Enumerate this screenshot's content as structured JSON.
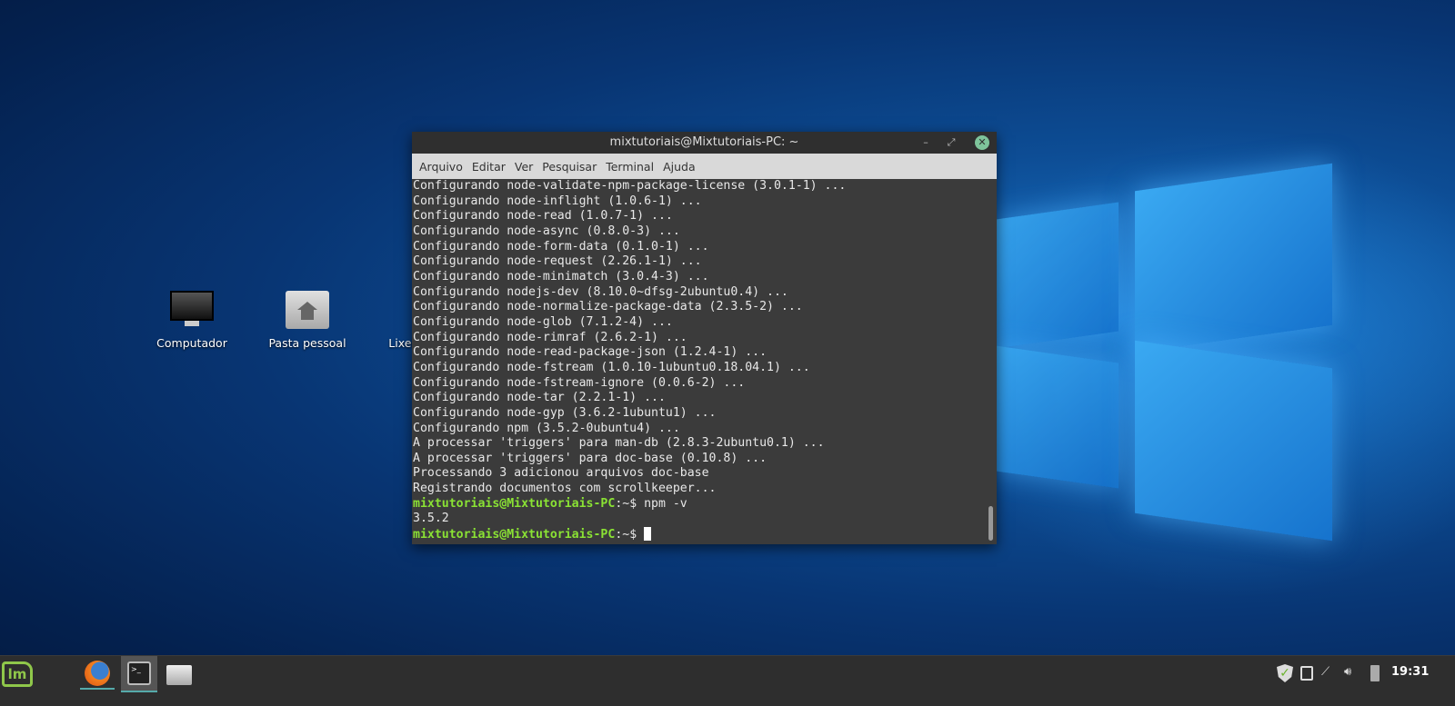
{
  "desktop": {
    "icons": [
      {
        "label": "Computador"
      },
      {
        "label": "Pasta pessoal"
      },
      {
        "label": "Lixeira"
      }
    ]
  },
  "terminal": {
    "title": "mixtutoriais@Mixtutoriais-PC: ~",
    "menu": [
      "Arquivo",
      "Editar",
      "Ver",
      "Pesquisar",
      "Terminal",
      "Ajuda"
    ],
    "lines": [
      "Configurando node-validate-npm-package-license (3.0.1-1) ...",
      "Configurando node-inflight (1.0.6-1) ...",
      "Configurando node-read (1.0.7-1) ...",
      "Configurando node-async (0.8.0-3) ...",
      "Configurando node-form-data (0.1.0-1) ...",
      "Configurando node-request (2.26.1-1) ...",
      "Configurando node-minimatch (3.0.4-3) ...",
      "Configurando nodejs-dev (8.10.0~dfsg-2ubuntu0.4) ...",
      "Configurando node-normalize-package-data (2.3.5-2) ...",
      "Configurando node-glob (7.1.2-4) ...",
      "Configurando node-rimraf (2.6.2-1) ...",
      "Configurando node-read-package-json (1.2.4-1) ...",
      "Configurando node-fstream (1.0.10-1ubuntu0.18.04.1) ...",
      "Configurando node-fstream-ignore (0.0.6-2) ...",
      "Configurando node-tar (2.2.1-1) ...",
      "Configurando node-gyp (3.6.2-1ubuntu1) ...",
      "Configurando npm (3.5.2-0ubuntu4) ...",
      "A processar 'triggers' para man-db (2.8.3-2ubuntu0.1) ...",
      "A processar 'triggers' para doc-base (0.10.8) ...",
      "Processando 3 adicionou arquivos doc-base",
      "Registrando documentos com scrollkeeper..."
    ],
    "prompt": "mixtutoriais@Mixtutoriais-PC",
    "prompt_suffix": ":~$ ",
    "command": "npm -v",
    "output": "3.5.2"
  },
  "taskbar": {
    "clock": "19:31"
  }
}
